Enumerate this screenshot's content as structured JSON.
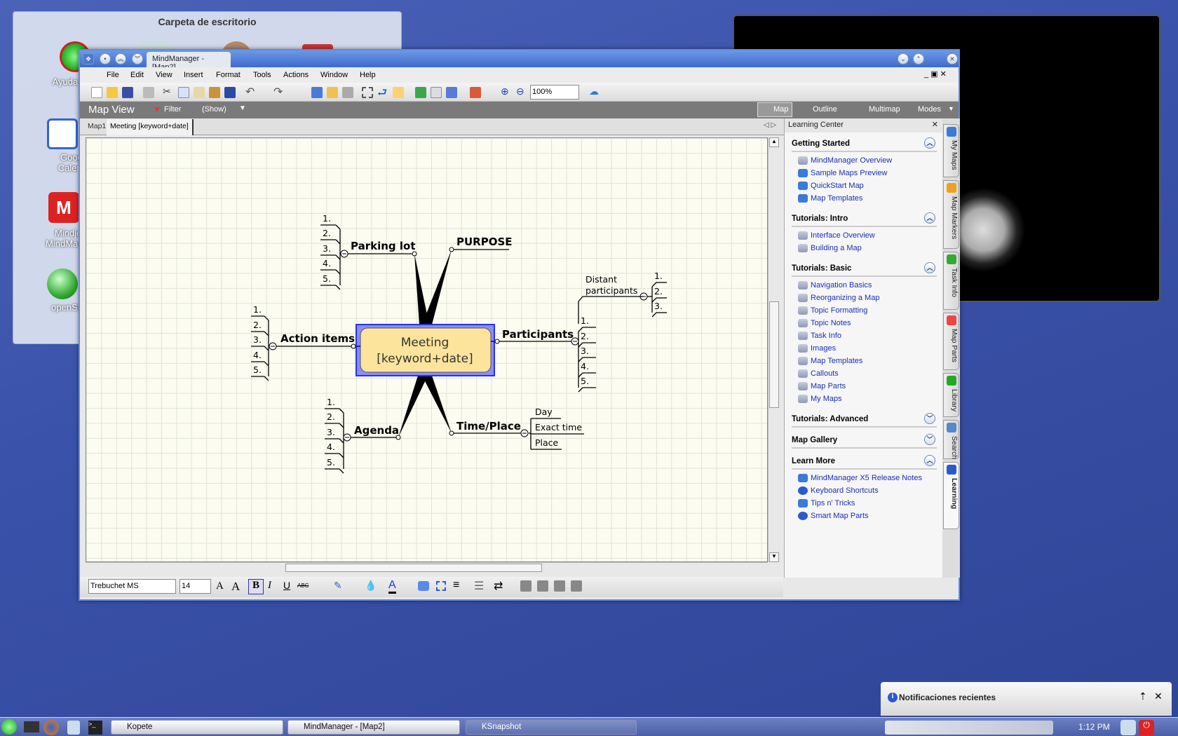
{
  "desktop": {
    "folder_title": "Carpeta de escritorio",
    "icons": [
      {
        "label1": "Ayuda en lí",
        "label2": ""
      },
      {
        "label1": "Google",
        "label2": "Calenda"
      },
      {
        "label1": "Mindjet",
        "label2": "MindManag"
      },
      {
        "label1": "openSUS",
        "label2": ""
      }
    ]
  },
  "window": {
    "title": "MindManager - [Map2]"
  },
  "menu": [
    "File",
    "Edit",
    "View",
    "Insert",
    "Format",
    "Tools",
    "Actions",
    "Window",
    "Help"
  ],
  "toolbar": {
    "zoom": "100%"
  },
  "mapbar": {
    "title": "Map View",
    "filter": "Filter",
    "show": "(Show)",
    "views": [
      "Map",
      "Outline",
      "Multimap"
    ],
    "modes": "Modes"
  },
  "doc_tabs": [
    "Map1",
    "Meeting [keyword+date]"
  ],
  "map": {
    "central": [
      "Meeting",
      "[keyword+date]"
    ],
    "topics": {
      "parking": "Parking lot",
      "purpose": "PURPOSE",
      "action": "Action items",
      "participants": "Participants",
      "agenda": "Agenda",
      "timeplace": "Time/Place"
    },
    "distant": [
      "Distant",
      "participants"
    ],
    "time_children": [
      "Day",
      "Exact time",
      "Place"
    ],
    "numbered5": [
      "1.",
      "2.",
      "3.",
      "4.",
      "5."
    ],
    "numbered3": [
      "1.",
      "2.",
      "3."
    ],
    "colors": {
      "central_fill": "#fde49c",
      "selection": "#3344ff"
    }
  },
  "format": {
    "font": "Trebuchet MS",
    "size": "14"
  },
  "learning": {
    "title": "Learning Center",
    "sections": [
      {
        "title": "Getting Started",
        "open": true,
        "items": [
          "MindManager Overview",
          "Sample Maps Preview",
          "QuickStart Map",
          "Map Templates"
        ]
      },
      {
        "title": "Tutorials: Intro",
        "open": true,
        "items": [
          "Interface Overview",
          "Building a Map"
        ]
      },
      {
        "title": "Tutorials: Basic",
        "open": true,
        "items": [
          "Navigation Basics",
          "Reorganizing a Map",
          "Topic Formatting",
          "Topic Notes",
          "Task Info",
          "Images",
          "Map Templates",
          "Callouts",
          "Map Parts",
          "My Maps"
        ]
      },
      {
        "title": "Tutorials: Advanced",
        "open": false,
        "items": []
      },
      {
        "title": "Map Gallery",
        "open": false,
        "items": []
      },
      {
        "title": "Learn More",
        "open": true,
        "items": [
          "MindManager X5 Release Notes",
          "Keyboard Shortcuts",
          "Tips n' Tricks",
          "Smart Map Parts"
        ]
      }
    ]
  },
  "side_tabs": [
    "My Maps",
    "Map Markers",
    "Task Info",
    "Map Parts",
    "Library",
    "Search",
    "Learning"
  ],
  "notification": {
    "title": "Notificaciones recientes"
  },
  "taskbar": {
    "tasks": [
      "Kopete",
      "MindManager - [Map2]",
      "KSnapshot"
    ],
    "clock": "1:12 PM"
  }
}
